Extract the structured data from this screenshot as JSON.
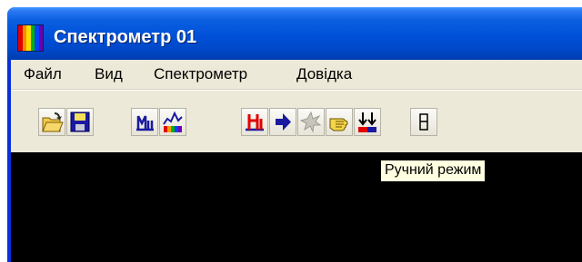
{
  "window": {
    "title": "Спектрометр 01",
    "icon": "spectrum-app-icon",
    "colors": {
      "titlebar": "#0050d8",
      "frame": "#ece9d8",
      "canvas": "#000000"
    }
  },
  "menu": [
    {
      "label": "Файл"
    },
    {
      "label": "Вид"
    },
    {
      "label": "Спектрометр"
    },
    {
      "label": "Довідка"
    }
  ],
  "toolbar": {
    "buttons": [
      {
        "icon": "open-folder-icon"
      },
      {
        "icon": "save-disk-icon"
      },
      {
        "icon": "measure-icon"
      },
      {
        "icon": "spectrum-chart-icon"
      },
      {
        "icon": "red-measure-icon"
      },
      {
        "icon": "arrow-right-icon"
      },
      {
        "icon": "stop-star-icon",
        "disabled": true
      },
      {
        "icon": "manual-hand-icon"
      },
      {
        "icon": "double-arrow-down-icon"
      },
      {
        "icon": "window-toggle-icon"
      }
    ]
  },
  "tooltip": {
    "text": "Ручний режим"
  }
}
